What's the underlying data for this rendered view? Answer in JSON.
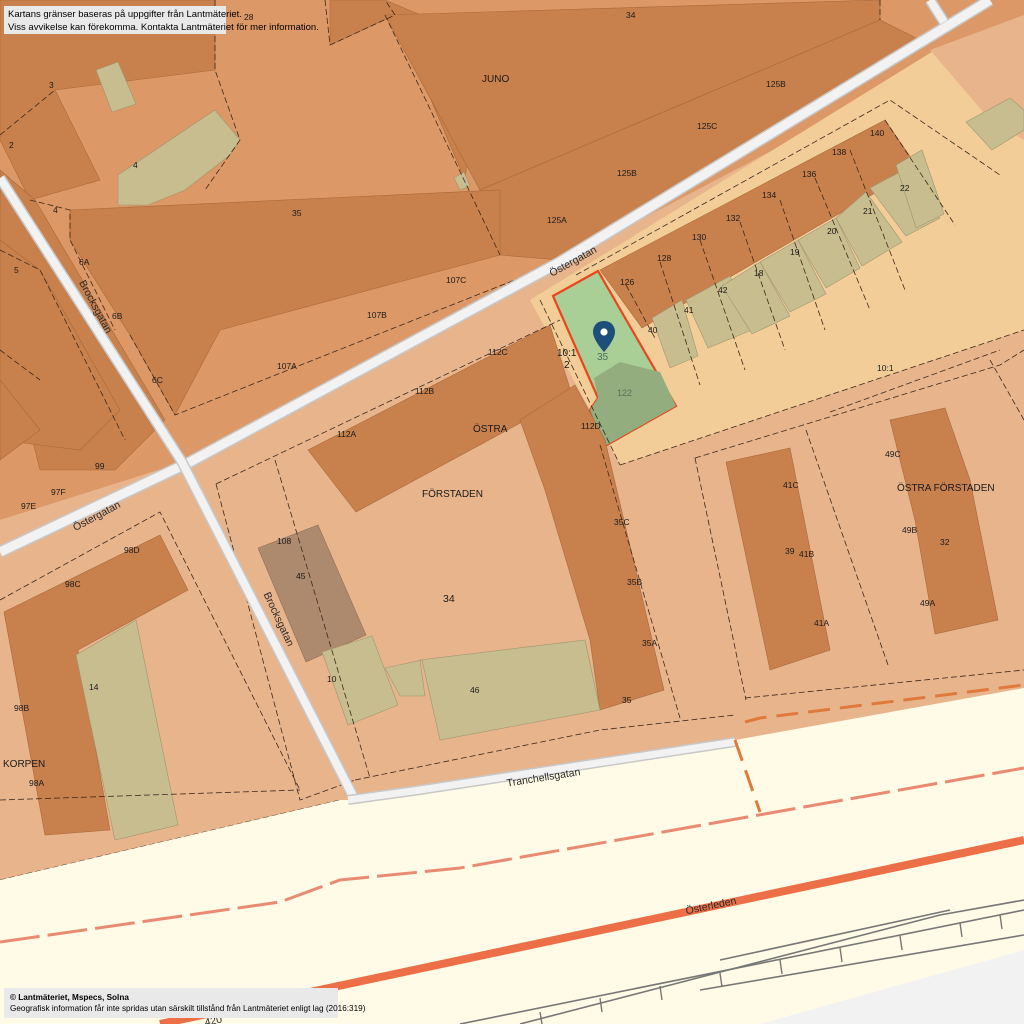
{
  "notice": {
    "line1": "Kartans gränser baseras på uppgifter från Lantmäteriet.",
    "line2": "Viss avvikelse kan förekomma. Kontakta Lantmäteriet för mer information."
  },
  "copyright": {
    "line1": "© Lantmäteriet, Mspecs, Solna",
    "line2": "Geografisk information får inte spridas utan särskilt tillstånd från Lantmäteriet enligt lag (2016:319)"
  },
  "marker": {
    "icon": "location-pin-icon",
    "color": "#1d4f7a"
  },
  "colors": {
    "land": "#e8b48c",
    "block": "#dc9866",
    "building": "#c8804c",
    "annex": "#c8bd8e",
    "selected_parcel": "#a9cf96",
    "selected_building": "#93ad7e",
    "parcel_outline": "#e8461e",
    "highlight_block": "#f3cd98",
    "road": "#f2f2f2",
    "rail_area": "#fffbe6",
    "motorway": "#ec6f47"
  },
  "streets": {
    "ostergatan_1": "Östergatan",
    "ostergatan_2": "Östergatan",
    "brocksgatan_1": "Brocksgatan",
    "brocksgatan_2": "Brocksgatan",
    "tranchellsgatan": "Tranchellsgatan",
    "osterleden": "Österleden"
  },
  "districts": {
    "juno": "JUNO",
    "ostra": "ÖSTRA",
    "forstaden": "FÖRSTADEN",
    "ostra_forstaden": "ÖSTRA FÖRSTADEN",
    "korpen": "KORPEN"
  },
  "selected": {
    "parcel_number": "35",
    "designation_a": "10:1",
    "designation_b": "2",
    "building_number": "122"
  },
  "labels": {
    "n28": "28",
    "n34_top": "34",
    "n3": "3",
    "n2": "2",
    "n4a": "4",
    "n4b": "4",
    "n35_juno": "35",
    "n5": "5",
    "n6a": "6A",
    "n6b": "6B",
    "n6c": "6C",
    "n125b_top": "125B",
    "n125c": "125C",
    "n125b": "125B",
    "n125a": "125A",
    "n107c": "107C",
    "n107b": "107B",
    "n107a": "107A",
    "n99": "99",
    "n97f": "97F",
    "n97e": "97E",
    "n126": "126",
    "n128": "128",
    "n130": "130",
    "n132": "132",
    "n134": "134",
    "n136": "136",
    "n138": "138",
    "n140": "140",
    "n22": "22",
    "n21": "21",
    "n20": "20",
    "n19": "19",
    "n18": "18",
    "n42": "42",
    "n41": "41",
    "n40": "40",
    "n10_1": "10:1",
    "n112c": "112C",
    "n112b": "112B",
    "n112a": "112A",
    "n112d": "112D",
    "n35c": "35C",
    "n35b": "35B",
    "n35a": "35A",
    "n35_bottom": "35",
    "n34": "34",
    "n108": "108",
    "n45": "45",
    "n10": "10",
    "n46": "46",
    "n98d": "98D",
    "n98c": "98C",
    "n98b": "98B",
    "n98a": "98A",
    "n14": "14",
    "n41c": "41C",
    "n39": "39",
    "n41b": "41B",
    "n41a": "41A",
    "n49c": "49C",
    "n49b": "49B",
    "n32": "32",
    "n49a": "49A",
    "n420": "420"
  }
}
